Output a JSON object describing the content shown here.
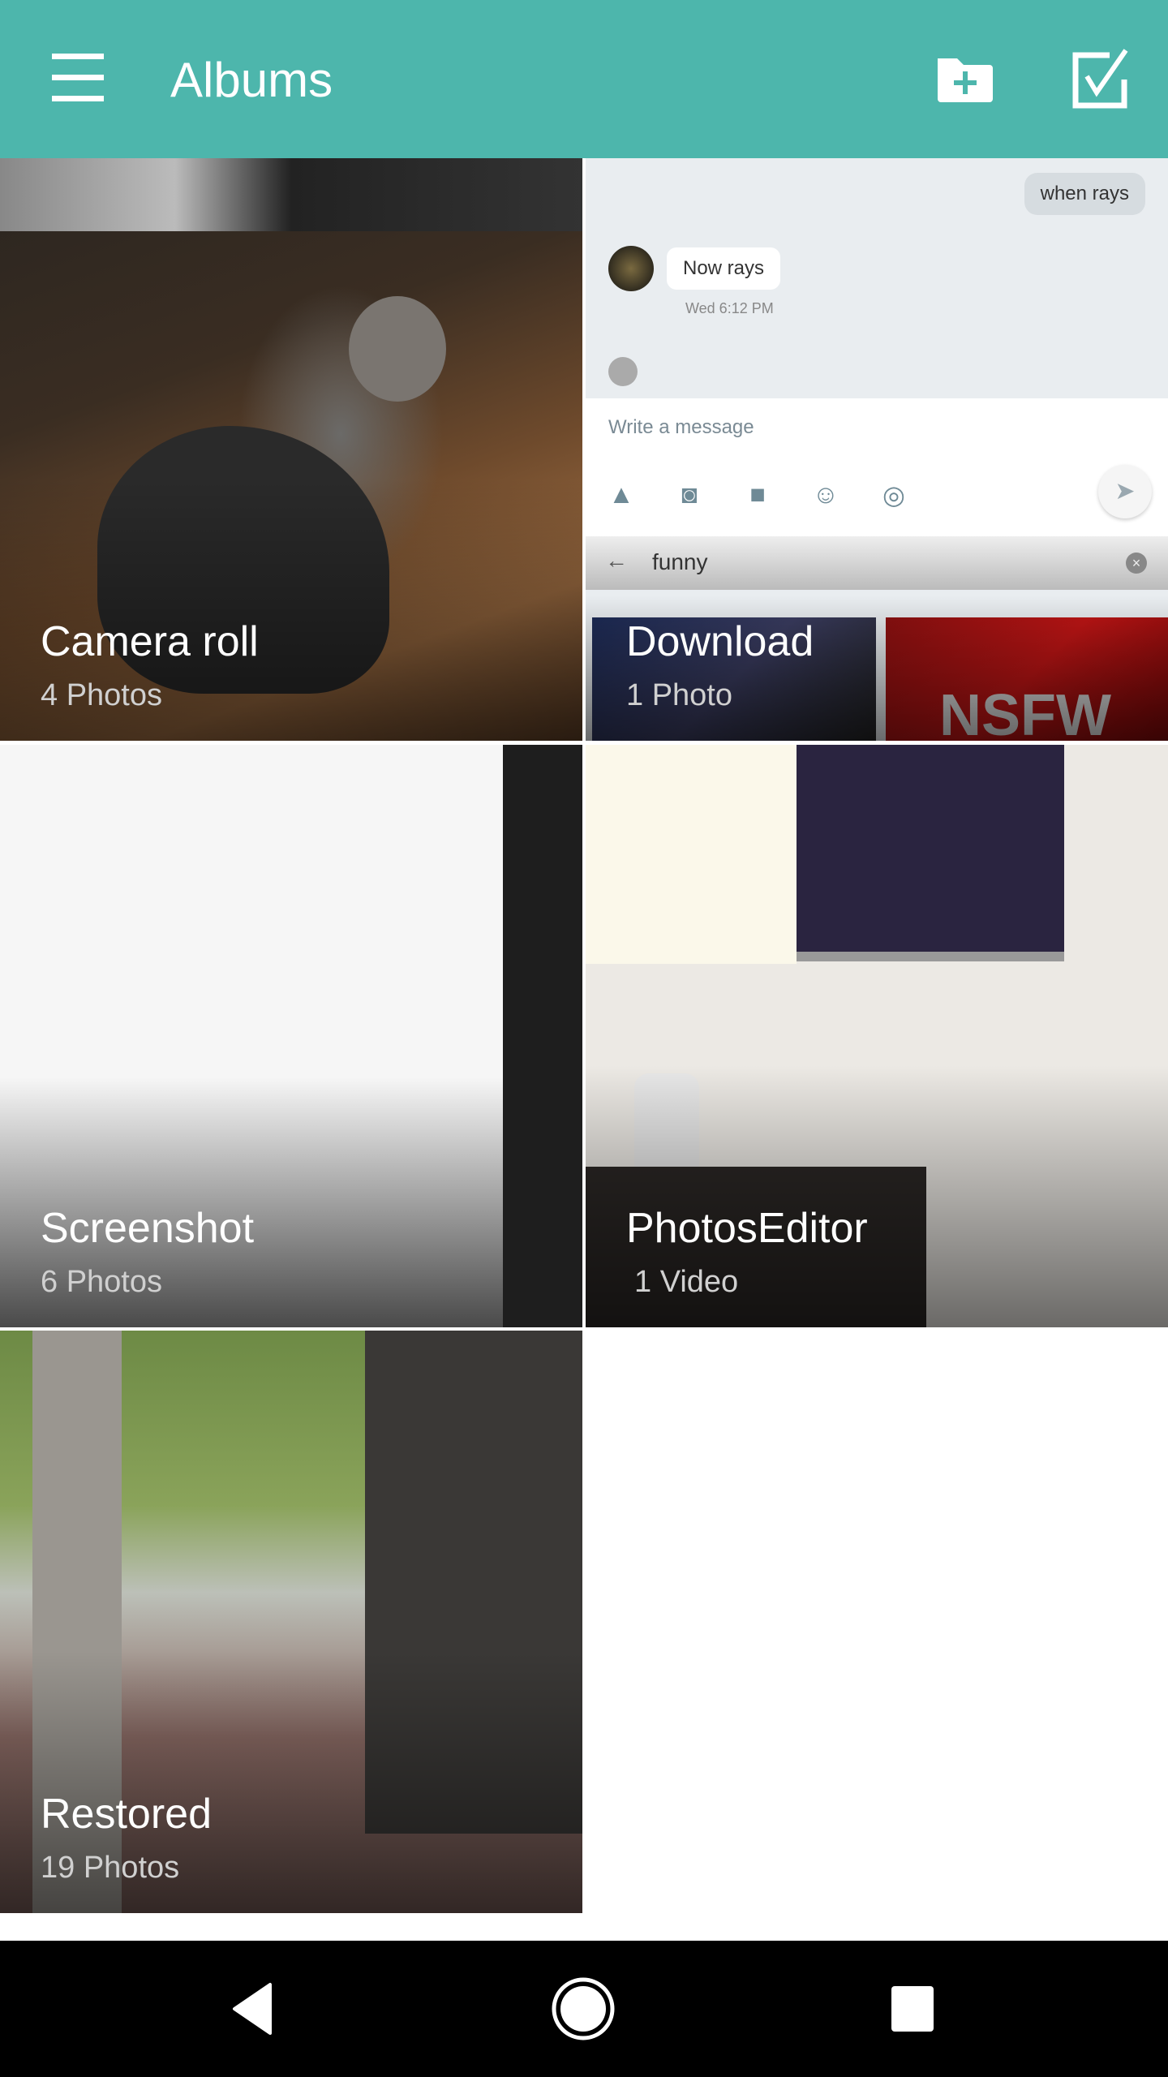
{
  "toolbar": {
    "title": "Albums",
    "background_color": "#4db6ac",
    "menu_icon": "hamburger-menu-icon",
    "actions": [
      {
        "name": "new-album",
        "icon": "create-new-folder-icon"
      },
      {
        "name": "select",
        "icon": "check-box-icon"
      }
    ]
  },
  "albums": [
    {
      "name": "Camera roll",
      "count": "4 Photos",
      "thumbnail": "cat sitting on wooden floor"
    },
    {
      "name": "Download",
      "count": "1 Photo",
      "thumbnail": "messaging app screenshot"
    },
    {
      "name": "Screenshot",
      "count": "6 Photos",
      "thumbnail": "blank screenshot"
    },
    {
      "name": "PhotosEditor",
      "count": "1 Video",
      "thumbnail": "wall with tv and smart speaker"
    },
    {
      "name": "Restored",
      "count": "19 Photos",
      "thumbnail": "tree-lined sidewalk street"
    }
  ],
  "download_thumbnail": {
    "outgoing_message": "when rays",
    "incoming_message": "Now rays",
    "incoming_time": "Wed 6:12 PM",
    "composer_placeholder": "Write a message",
    "gif_search_query": "funny",
    "gif_label": "NSFW"
  },
  "navbar": {
    "buttons": [
      "back",
      "home",
      "recents"
    ]
  }
}
